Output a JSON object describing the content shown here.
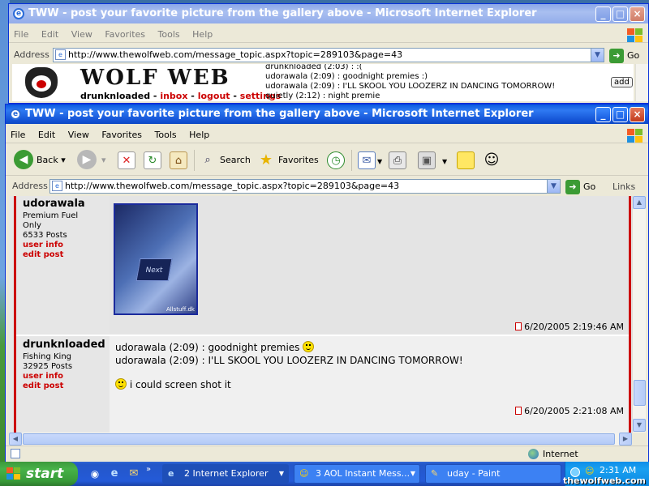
{
  "back_window": {
    "title": "TWW - post your favorite picture from the gallery above - Microsoft Internet Explorer",
    "menu": [
      "File",
      "Edit",
      "View",
      "Favorites",
      "Tools",
      "Help"
    ],
    "address_label": "Address",
    "address_url": "http://www.thewolfweb.com/message_topic.aspx?topic=289103&page=43",
    "go_label": "Go",
    "site_logo_text": "WOLF WEB",
    "nav": {
      "user": "drunknloaded",
      "inbox": "inbox",
      "logout": "logout",
      "settings": "settings"
    },
    "ticker": [
      "drunknloaded (2:03) : :(",
      "udorawala (2:09) : goodnight premies :)",
      "udorawala (2:09) : I'LL SKOOL YOU LOOZERZ IN DANCING TOMORROW!",
      "quietly (2:12) : night premie"
    ],
    "add_button": "add"
  },
  "front_window": {
    "title": "TWW - post your favorite picture from the gallery above - Microsoft Internet Explorer",
    "menu": [
      "File",
      "Edit",
      "View",
      "Favorites",
      "Tools",
      "Help"
    ],
    "toolbar": {
      "back": "Back",
      "search": "Search",
      "favorites": "Favorites"
    },
    "address_label": "Address",
    "address_url": "http://www.thewolfweb.com/message_topic.aspx?topic=289103&page=43",
    "go_label": "Go",
    "links_label": "Links",
    "status_zone": "Internet"
  },
  "posts": [
    {
      "username": "udorawala",
      "rank": "Premium Fuel Only",
      "posts": "6533 Posts",
      "user_info": "user info",
      "edit_post": "edit post",
      "image_caption": "Allstuff.dk",
      "key_label": "Next",
      "timestamp": "6/20/2005 2:19:46 AM"
    },
    {
      "username": "drunknloaded",
      "rank": "Fishing King",
      "posts": "32925 Posts",
      "user_info": "user info",
      "edit_post": "edit post",
      "lines": [
        "udorawala (2:09) : goodnight premies",
        "udorawala (2:09) : I'LL SKOOL YOU LOOZERZ IN DANCING TOMORROW!",
        "i could screen shot it"
      ],
      "timestamp": "6/20/2005 2:21:08 AM"
    }
  ],
  "taskbar": {
    "start": "start",
    "items": [
      {
        "label": "2 Internet Explorer"
      },
      {
        "label": "3 AOL Instant Mess..."
      },
      {
        "label": "uday - Paint"
      }
    ],
    "clock": "2:31 AM",
    "watermark": "thewolfweb.com"
  },
  "colors": {
    "xp_blue": "#0a5ae0",
    "start_green": "#389a38",
    "post_red": "#cc0000",
    "link_red": "#cc0000"
  }
}
